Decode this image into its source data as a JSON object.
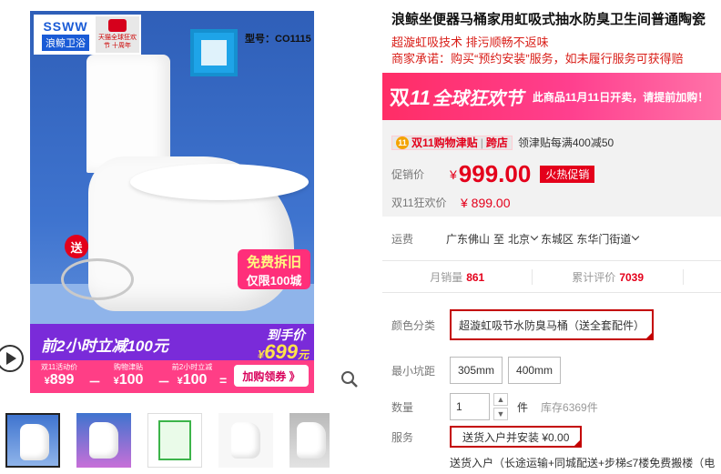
{
  "gallery": {
    "brand_en": "SSWW",
    "brand_cn": "浪鲸卫浴",
    "tmall_note": "天猫全球狂欢节 十周年",
    "model": "型号：CO1115",
    "gift_tag": "送",
    "free_badge_1": "免费拆旧",
    "free_badge_2": "仅限100城",
    "promo_text": "前2小时立减100元",
    "arrive_label": "到手价",
    "arrive_price": "699",
    "arrive_unit": "元",
    "cells": [
      {
        "t": "双11活动价",
        "v": "899"
      },
      {
        "t": "购物津贴",
        "v": "100"
      },
      {
        "t": "前2小时立减",
        "v": "100"
      }
    ],
    "ops": [
      "－",
      "－",
      "="
    ],
    "coupon": "加购领券 》",
    "yen": "¥"
  },
  "detail": {
    "title": "浪鲸坐便器马桶家用虹吸式抽水防臭卫生间普通陶瓷",
    "subtitle": "超漩虹吸技术 排污顺畅不返味",
    "promise": "商家承诺：购买“预约安装”服务，如未履行服务可获得赔",
    "banner": {
      "shuang": "双",
      "eleven": "11",
      "kh": "全球狂欢节",
      "notice": "此商品11月11日开卖，请提前加购！"
    },
    "allowance": {
      "icon": "11",
      "tag": "双11购物津贴",
      "tag2": "跨店",
      "desc": "领津贴每满400减50"
    },
    "price_label": "促销价",
    "price_yen": "¥",
    "price": "999.00",
    "hot_tag": "火热促销",
    "d11_label": "双11狂欢价",
    "d11_price": "¥ 899.00",
    "ship_label": "运费",
    "ship_from": "广东佛山",
    "ship_to_word": "至",
    "ship_to_1": "北京",
    "ship_to_2": "东城区 东华门街道",
    "sales_label": "月销量",
    "sales": "861",
    "reviews_label": "累计评价",
    "reviews": "7039",
    "color_label": "颜色分类",
    "color_option": "超漩虹吸节水防臭马桶（送全套配件）",
    "pit_label": "最小坑距",
    "pit_options": [
      "305mm",
      "400mm"
    ],
    "qty_label": "数量",
    "qty": "1",
    "qty_unit": "件",
    "stock": "库存6369件",
    "service_label": "服务",
    "service_option": "送货入户并安装 ¥0.00",
    "service_note": "送货入户（长途运输+同城配送+步梯≤7楼免费搬楼（电"
  },
  "colors": {
    "accent": "#e4001b",
    "banner": "#ff2d66",
    "promo_purple": "#7a2bd9",
    "promo_pink": "#ff3e86"
  }
}
